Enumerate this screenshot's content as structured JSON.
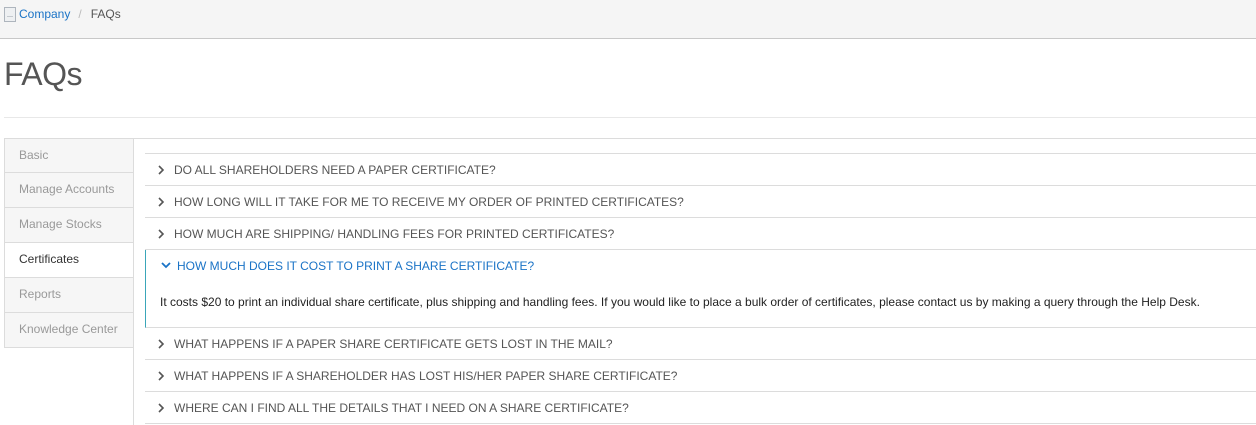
{
  "breadcrumb": {
    "icon": "company-icon",
    "company_label": "Company",
    "separator": "/",
    "current": "FAQs"
  },
  "page": {
    "title": "FAQs"
  },
  "sidebar": {
    "items": [
      {
        "label": "Basic",
        "active": false
      },
      {
        "label": "Manage Accounts",
        "active": false
      },
      {
        "label": "Manage Stocks",
        "active": false
      },
      {
        "label": "Certificates",
        "active": true
      },
      {
        "label": "Reports",
        "active": false
      },
      {
        "label": "Knowledge Center",
        "active": false
      }
    ]
  },
  "faqs": [
    {
      "question": "DO ALL SHAREHOLDERS NEED A PAPER CERTIFICATE?",
      "open": false
    },
    {
      "question": "HOW LONG WILL IT TAKE FOR ME TO RECEIVE MY ORDER OF PRINTED CERTIFICATES?",
      "open": false
    },
    {
      "question": "HOW MUCH ARE SHIPPING/ HANDLING FEES FOR PRINTED CERTIFICATES?",
      "open": false
    },
    {
      "question": "HOW MUCH DOES IT COST TO PRINT A SHARE CERTIFICATE?",
      "open": true,
      "answer": "It costs $20 to print an individual share certificate, plus shipping and handling fees. If you would like to place a bulk order of certificates, please contact us by making a query through the Help Desk."
    },
    {
      "question": "WHAT HAPPENS IF A PAPER SHARE CERTIFICATE GETS LOST IN THE MAIL?",
      "open": false
    },
    {
      "question": "WHAT HAPPENS IF A SHAREHOLDER HAS LOST HIS/HER PAPER SHARE CERTIFICATE?",
      "open": false
    },
    {
      "question": "WHERE CAN I FIND ALL THE DETAILS THAT I NEED ON A SHARE CERTIFICATE?",
      "open": false
    }
  ],
  "icons": {
    "collapsed": "chevron-right-icon",
    "expanded": "chevron-down-icon"
  },
  "colors": {
    "link": "#1a73c6",
    "open_border": "#3aa6b9"
  }
}
